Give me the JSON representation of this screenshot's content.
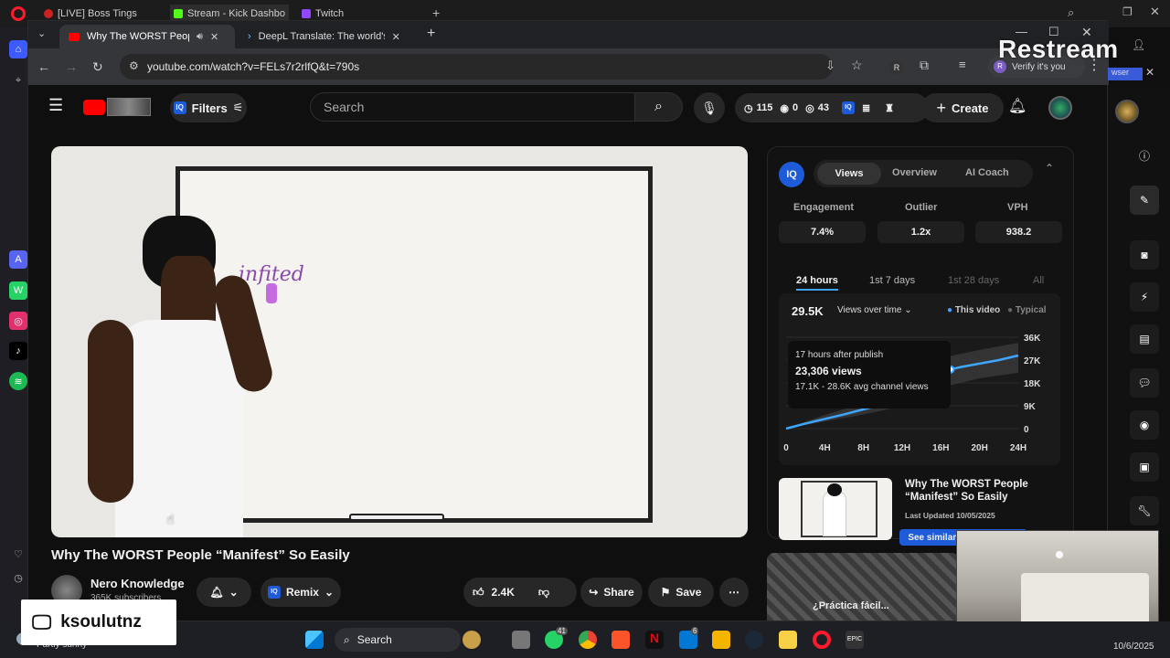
{
  "outer_tabs": [
    {
      "label": "[LIVE] Boss Tings",
      "color": "#c22"
    },
    {
      "label": "Stream - Kick Dashbo",
      "color": "#53fc18"
    },
    {
      "label": "Twitch",
      "color": "#9146ff"
    }
  ],
  "browser": {
    "tabs": [
      {
        "label": "Why The WORST People \"M",
        "active": true
      },
      {
        "label": "DeepL Translate: The world's m",
        "active": false
      }
    ],
    "url": "youtube.com/watch?v=FELs7r2rlfQ&t=790s",
    "verify_label": "Verify it's you",
    "profile_initial": "R",
    "profile_badge": "R"
  },
  "youtube": {
    "filters_label": "Filters",
    "search_placeholder": "Search",
    "stats": {
      "a": "115",
      "b": "0",
      "c": "43"
    },
    "create_label": "Create",
    "video": {
      "marker_text": "infited"
    },
    "title": "Why The WORST People “Manifest” So Easily",
    "channel": {
      "name": "Nero Knowledge",
      "subs": "365K subscribers"
    },
    "actions": {
      "remix": "Remix",
      "likes": "2.4K",
      "share": "Share",
      "save": "Save"
    }
  },
  "iq_panel": {
    "logo": "IQ",
    "tabs": [
      "Views",
      "Overview",
      "AI Coach"
    ],
    "active_tab": "Views",
    "metrics": [
      {
        "label": "Engagement",
        "value": "7.4%"
      },
      {
        "label": "Outlier",
        "value": "1.2x"
      },
      {
        "label": "VPH",
        "value": "938.2"
      }
    ],
    "ranges": [
      "24 hours",
      "1st 7 days",
      "1st 28 days",
      "All"
    ],
    "active_range": "24 hours",
    "total": "29.5K",
    "dropdown": "Views over time",
    "legend": [
      "This video",
      "Typical"
    ],
    "tooltip": {
      "title": "17 hours after publish",
      "views": "23,306 views",
      "avg": "17.1K - 28.6K avg channel views"
    },
    "thumb_card": {
      "title": "Why The WORST People “Manifest” So Easily",
      "updated": "Last Updated 10/05/2025",
      "button": "See similar thumbnails"
    },
    "recommended_text": "¿Práctica fácil..."
  },
  "chart_data": {
    "type": "line",
    "x_ticks": [
      "0",
      "4H",
      "8H",
      "12H",
      "16H",
      "20H",
      "24H"
    ],
    "y_ticks": [
      "36K",
      "27K",
      "18K",
      "9K",
      "0"
    ],
    "ylim": [
      0,
      36000
    ],
    "series": [
      {
        "name": "This video",
        "x": [
          0,
          2,
          4,
          6,
          8,
          10,
          12,
          14,
          16,
          17,
          18,
          20,
          22,
          24
        ],
        "values": [
          0,
          2000,
          3800,
          5600,
          7600,
          9500,
          12000,
          15500,
          19500,
          23306,
          24200,
          25600,
          27000,
          28800
        ]
      }
    ],
    "typical_band": {
      "x": [
        0,
        4,
        8,
        12,
        16,
        17,
        20,
        24
      ],
      "low": [
        0,
        2800,
        5600,
        8800,
        14400,
        17100,
        19800,
        22000
      ],
      "high": [
        0,
        5400,
        10000,
        16000,
        24400,
        28600,
        31000,
        33800
      ]
    },
    "grid": true,
    "legend": "top-right"
  },
  "restream": {
    "logo": "Restream",
    "username": "ksoulutnz",
    "webcam_label": "ksoulutnz",
    "side_text": "wser"
  },
  "taskbar": {
    "search": "Search",
    "weather": "Partly sunny",
    "date": "10/6/2025",
    "badge_whatsapp": "41",
    "badge_mail": "6",
    "epic": "EPIC"
  }
}
